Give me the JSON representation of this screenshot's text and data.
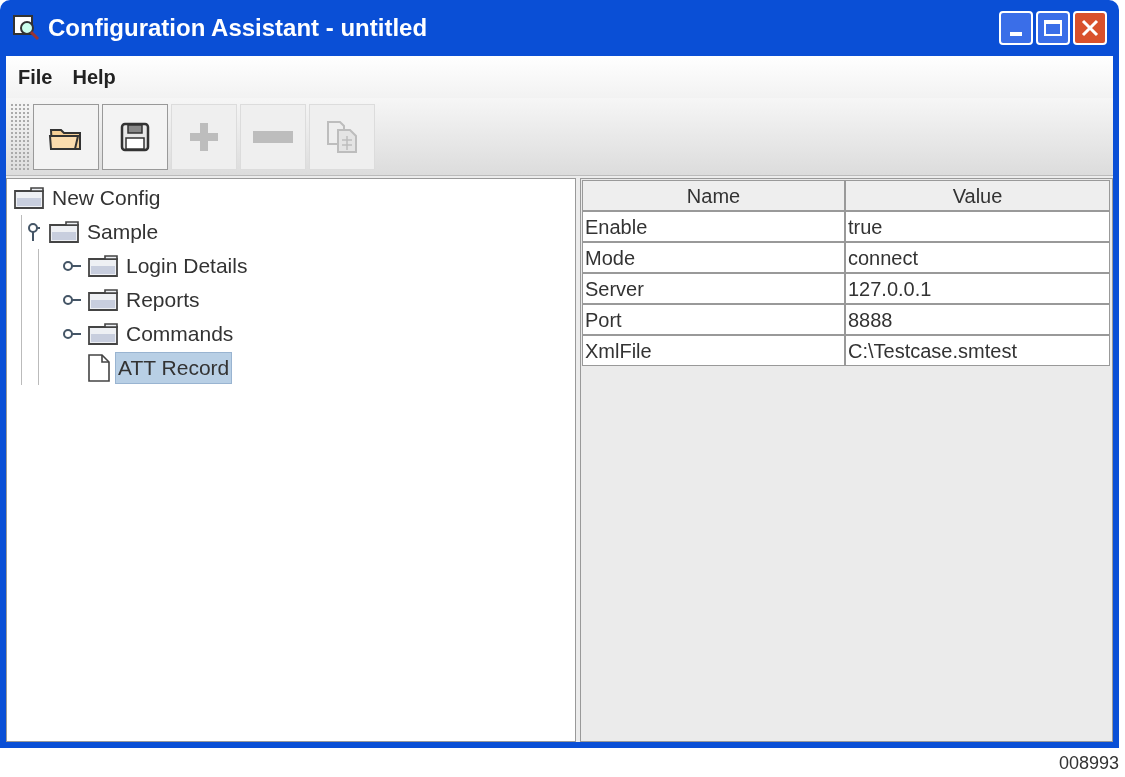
{
  "window": {
    "title": "Configuration Assistant - untitled"
  },
  "menu": [
    "File",
    "Help"
  ],
  "toolbar": [
    {
      "kind": "open",
      "disabled": false
    },
    {
      "kind": "save",
      "disabled": false
    },
    {
      "kind": "add",
      "disabled": true
    },
    {
      "kind": "remove",
      "disabled": true
    },
    {
      "kind": "copy",
      "disabled": true
    }
  ],
  "tree": [
    {
      "label": "New Config",
      "kind": "folder",
      "selected": false,
      "children": [
        {
          "label": "Sample",
          "kind": "folder",
          "selected": false,
          "expanded": true,
          "children": [
            {
              "label": "Login Details",
              "kind": "folder",
              "selected": false,
              "expanded": false
            },
            {
              "label": "Reports",
              "kind": "folder",
              "selected": false,
              "expanded": false
            },
            {
              "label": "Commands",
              "kind": "folder",
              "selected": false,
              "expanded": false
            },
            {
              "label": "ATT Record",
              "kind": "file",
              "selected": true
            }
          ]
        }
      ]
    }
  ],
  "table": {
    "columns": [
      "Name",
      "Value"
    ],
    "rows": [
      [
        "Enable",
        "true"
      ],
      [
        "Mode",
        "connect"
      ],
      [
        "Server",
        "127.0.0.1"
      ],
      [
        "Port",
        "8888"
      ],
      [
        "XmlFile",
        "C:\\Testcase.smtest"
      ]
    ]
  },
  "figure_number": "008993"
}
